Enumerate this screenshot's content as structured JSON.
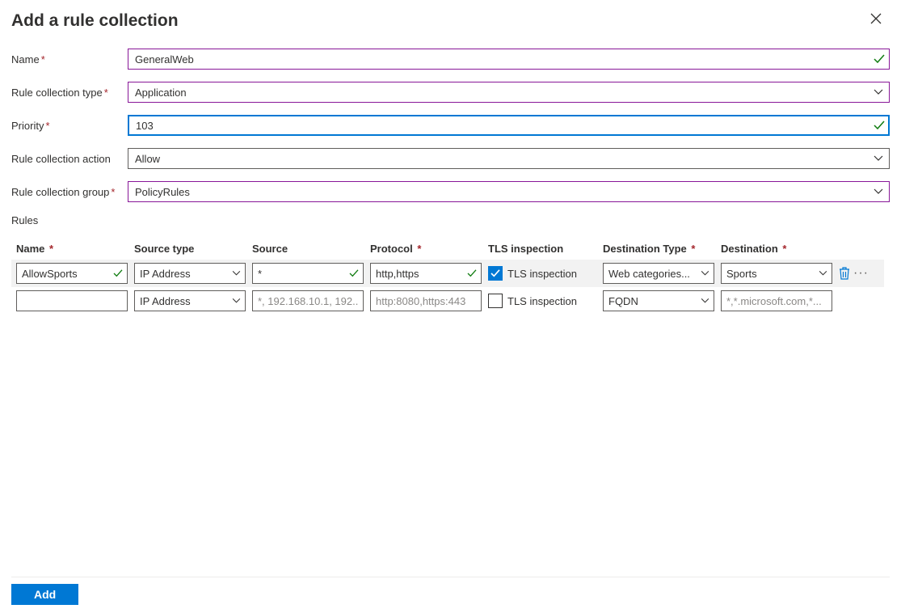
{
  "header": {
    "title": "Add a rule collection"
  },
  "form": {
    "name_label": "Name",
    "name_value": "GeneralWeb",
    "type_label": "Rule collection type",
    "type_value": "Application",
    "priority_label": "Priority",
    "priority_value": "103",
    "action_label": "Rule collection action",
    "action_value": "Allow",
    "group_label": "Rule collection group",
    "group_value": "PolicyRules",
    "rules_label": "Rules"
  },
  "columns": {
    "name": "Name",
    "stype": "Source type",
    "source": "Source",
    "protocol": "Protocol",
    "tls": "TLS inspection",
    "dtype": "Destination Type",
    "dest": "Destination"
  },
  "rows": [
    {
      "name": "AllowSports",
      "stype": "IP Address",
      "source": "*",
      "protocol": "http,https",
      "tls_checked": true,
      "tls_label": "TLS inspection",
      "dtype": "Web categories...",
      "dest": "Sports"
    },
    {
      "name": "",
      "stype": "IP Address",
      "source_ph": "*, 192.168.10.1, 192...",
      "protocol_ph": "http:8080,https:443",
      "tls_checked": false,
      "tls_label": "TLS inspection",
      "dtype": "FQDN",
      "dest_ph": "*,*.microsoft.com,*..."
    }
  ],
  "footer": {
    "add": "Add"
  },
  "colors": {
    "accent": "#0078d4",
    "purple": "#881798",
    "green": "#107c10"
  }
}
